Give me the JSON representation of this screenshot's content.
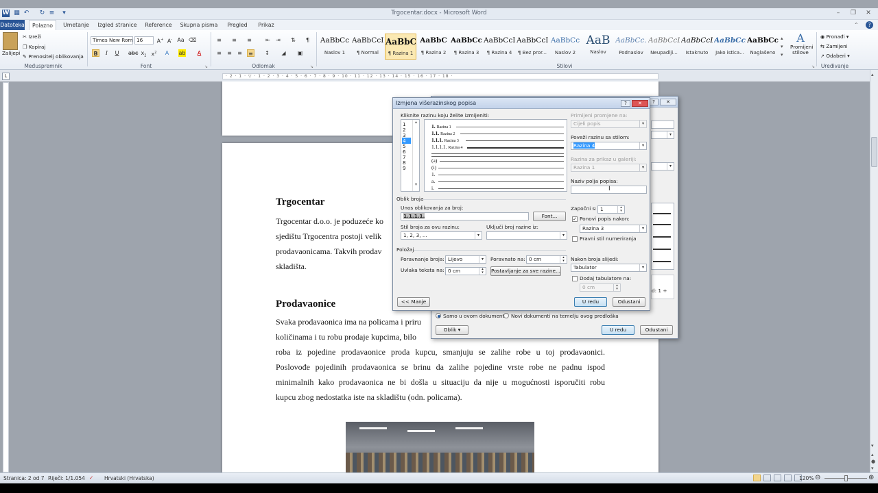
{
  "window": {
    "title": "Trgocentar.docx - Microsoft Word"
  },
  "tabs": [
    {
      "label": "Datoteka"
    },
    {
      "label": "Polazno"
    },
    {
      "label": "Umetanje"
    },
    {
      "label": "Izgled stranice"
    },
    {
      "label": "Reference"
    },
    {
      "label": "Skupna pisma"
    },
    {
      "label": "Pregled"
    },
    {
      "label": "Prikaz"
    }
  ],
  "ribbon": {
    "clipboard": {
      "paste": "Zalijepi",
      "cut": "Izreži",
      "copy": "Kopiraj",
      "format_painter": "Prenositelj oblikovanja",
      "group": "Međuspremnik"
    },
    "font": {
      "name": "Times New Rom",
      "size": "16",
      "group": "Font"
    },
    "paragraph": {
      "group": "Odlomak"
    },
    "styles": {
      "group": "Stilovi",
      "items": [
        {
          "sample": "AaBbCc",
          "name": "Naslov 1"
        },
        {
          "sample": "AaBbCcI",
          "name": "¶ Normal"
        },
        {
          "sample": "AaBbC",
          "name": "¶ Razina 1"
        },
        {
          "sample": "AaBbC",
          "name": "¶ Razina 2"
        },
        {
          "sample": "AaBbCcI",
          "name": "¶ Razina 3"
        },
        {
          "sample": "AaBbCcI",
          "name": "¶ Razina 4"
        },
        {
          "sample": "AaBbCcI",
          "name": "¶ Bez pror..."
        },
        {
          "sample": "AaBbCc",
          "name": "Naslov 2"
        },
        {
          "sample": "AaB",
          "name": "Naslov"
        },
        {
          "sample": "AaBbCc.",
          "name": "Podnaslov"
        },
        {
          "sample": "AaBbCcD",
          "name": "Neupadlji..."
        },
        {
          "sample": "AaBbCcD",
          "name": "Istaknuto"
        },
        {
          "sample": "AaBbCcD",
          "name": "Jako istica..."
        },
        {
          "sample": "AaBbCcD",
          "name": "Naglašeno"
        }
      ],
      "change": "Promijeni stilove"
    },
    "editing": {
      "group": "Uređivanje",
      "find": "Pronađi",
      "replace": "Zamijeni",
      "select": "Odaberi"
    }
  },
  "document": {
    "h1": "Trgocentar",
    "p1": [
      "Trgocentar d.o.o. je poduzeće ko",
      "sjedištu Trgocentra postoji velik",
      "prodavaonicama. Takvih prodav",
      "skladišta."
    ],
    "h2": "Prodavaonice",
    "p2": [
      "Svaka prodavaonica ima na policama i priru",
      "količinama i tu robu prodaje kupcima, bilo",
      "roba iz pojedine prodavaonice proda kupcu, smanjuju se zalihe robe u toj prodavaonici.",
      "Poslovođe pojedinih prodavaonica se brinu da zalihe pojedine vrste robe ne padnu ispod",
      "minimalnih kako prodavaonica ne bi došla u situaciju da nije u mogućnosti isporučiti robu",
      "kupcu zbog nedostatka iste na skladištu (odn. policama)."
    ]
  },
  "back_dialog": {
    "radio1": "Samo u ovom dokumentu",
    "radio2": "Novi dokumenti na temelju ovog predloška",
    "format": "Oblik",
    "ok": "U redu",
    "cancel": "Odustani",
    "snippet": "d: 1 +"
  },
  "dialog": {
    "title": "Izmjena višerazinskog popisa",
    "click_level": "Kliknite razinu koju želite izmijeniti:",
    "levels": [
      "1",
      "2",
      "3",
      "4",
      "5",
      "6",
      "7",
      "8",
      "9"
    ],
    "preview": [
      {
        "num": "1.",
        "label": "Razina 1"
      },
      {
        "num": "1.1.",
        "label": "Razina 2"
      },
      {
        "num": "1.1.1.",
        "label": "Razina 3"
      },
      {
        "num": "1.1.1.1.",
        "label": "Razina 4"
      },
      {
        "num": "",
        "label": ""
      },
      {
        "num": "(a)",
        "label": ""
      },
      {
        "num": "(i)",
        "label": ""
      },
      {
        "num": "1.",
        "label": ""
      },
      {
        "num": "a.",
        "label": ""
      },
      {
        "num": "i.",
        "label": ""
      }
    ],
    "apply_to_label": "Primijeni promjene na:",
    "apply_to_value": "Cijeli popis",
    "link_style_label": "Poveži razinu sa stilom:",
    "link_style_value": "Razina 4",
    "gallery_label": "Razina za prikaz u galeriji:",
    "gallery_value": "Razina 1",
    "field_name_label": "Naziv polja popisa:",
    "number_format_section": "Oblik broja",
    "enter_format_label": "Unos oblikovanja za broj:",
    "enter_format_value": "1.1.1.1.",
    "font_button": "Font...",
    "number_style_label": "Stil broja za ovu razinu:",
    "number_style_value": "1, 2, 3, ...",
    "include_level_label": "Uključi broj razine iz:",
    "start_at_label": "Započni s:",
    "start_at_value": "1",
    "restart_label": "Ponovi popis nakon:",
    "restart_value": "Razina 3",
    "legal_label": "Pravni stil numeriranja",
    "position_section": "Položaj",
    "alignment_label": "Poravnanje broja:",
    "alignment_value": "Lijevo",
    "aligned_at_label": "Poravnato na:",
    "aligned_at_value": "0 cm",
    "indent_label": "Uvlaka teksta na:",
    "indent_value": "0 cm",
    "set_all_button": "Postavljanje za sve razine...",
    "follow_label": "Nakon broja slijedi:",
    "follow_value": "Tabulator",
    "add_tab_label": "Dodaj tabulatore na:",
    "add_tab_value": "0 cm",
    "less_button": "<< Manje",
    "ok_button": "U redu",
    "cancel_button": "Odustani"
  },
  "status": {
    "page": "Stranica: 2 od 7",
    "words": "Riječi: 1/1.054",
    "language": "Hrvatski (Hrvatska)",
    "zoom": "120%"
  }
}
